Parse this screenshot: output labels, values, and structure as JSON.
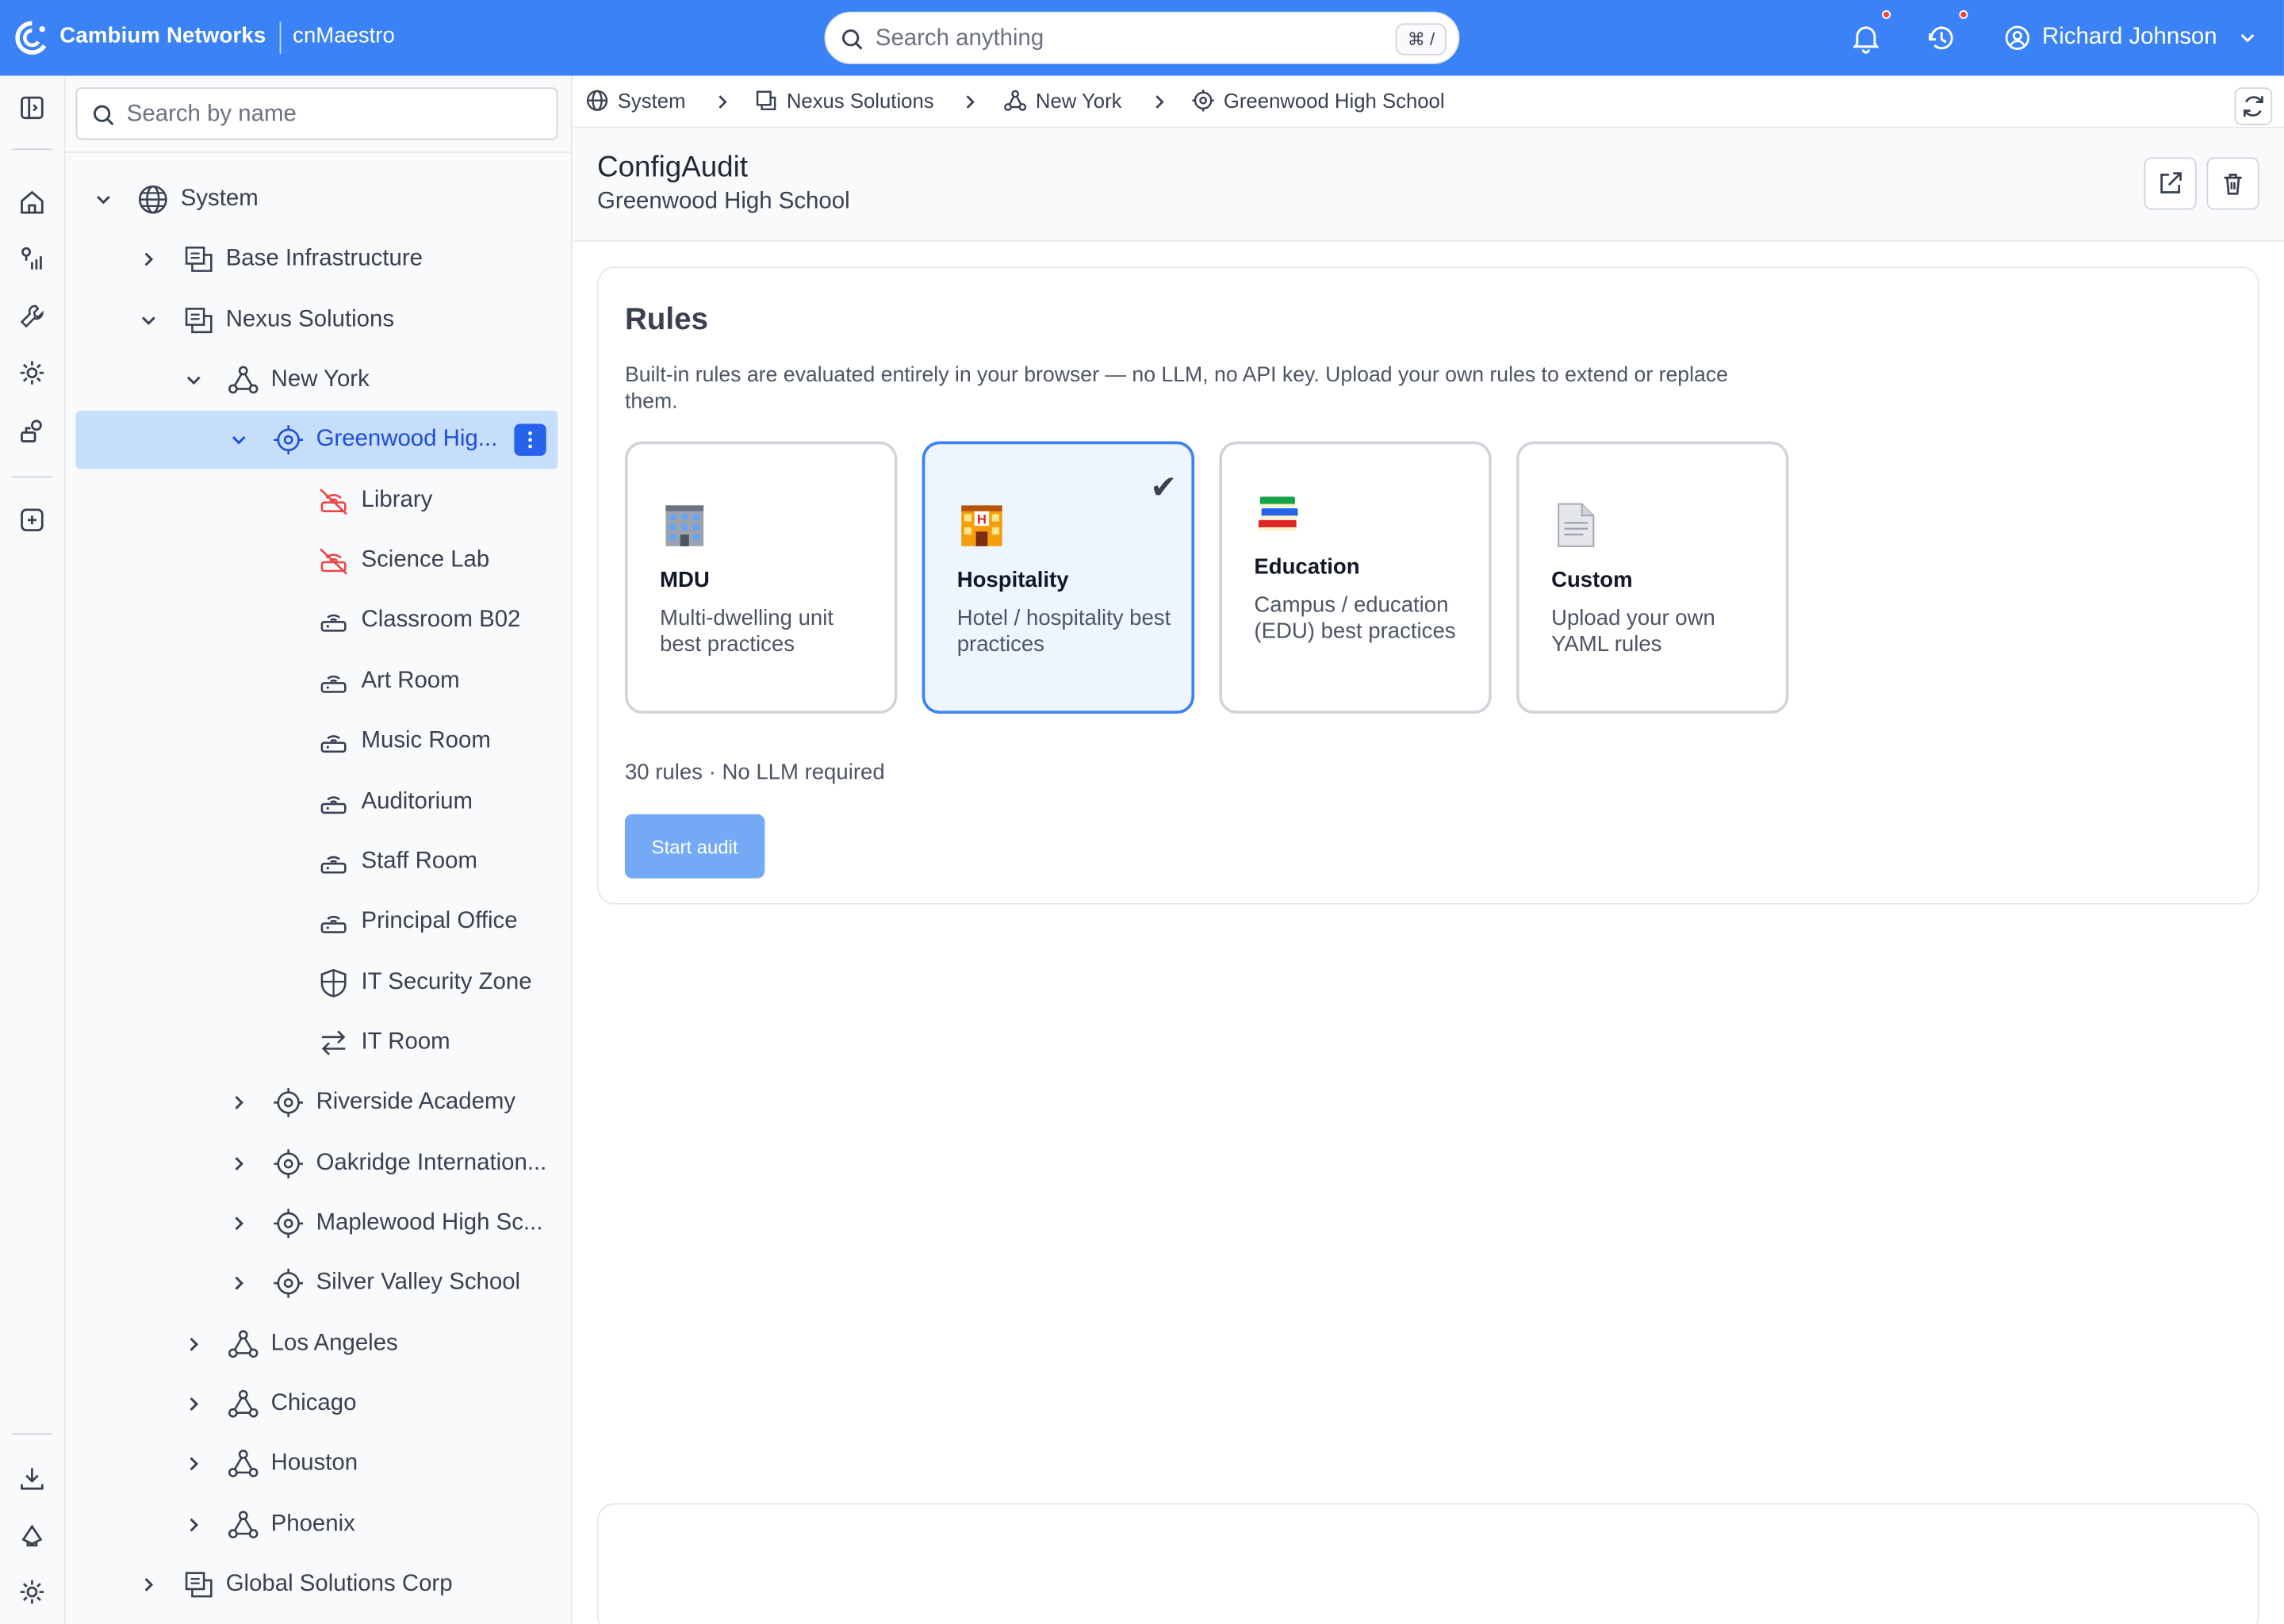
{
  "topbar": {
    "brand": "Cambium Networks",
    "product": "cnMaestro",
    "search_placeholder": "Search anything",
    "shortcut": "⌘ /",
    "user_name": "Richard Johnson",
    "accent_color": "#3b82f6"
  },
  "rail": {
    "icons": [
      "sidebar-toggle-icon",
      "home-icon",
      "monitor-icon",
      "wrench-icon",
      "gear-icon",
      "tools-icon",
      "add-icon",
      "download-icon",
      "feedback-icon",
      "settings-icon"
    ]
  },
  "tree": {
    "search_placeholder": "Search by name",
    "nodes": [
      {
        "label": "System",
        "icon": "globe-icon",
        "expanded": true
      },
      {
        "label": "Base Infrastructure",
        "icon": "org-icon",
        "expanded": false
      },
      {
        "label": "Nexus Solutions",
        "icon": "org-icon",
        "expanded": true
      },
      {
        "label": "New York",
        "icon": "network-icon",
        "expanded": true
      },
      {
        "label": "Greenwood Hig...",
        "icon": "site-icon",
        "expanded": true,
        "selected": true
      },
      {
        "label": "Library",
        "icon": "offline-ap-icon"
      },
      {
        "label": "Science Lab",
        "icon": "offline-ap-icon"
      },
      {
        "label": "Classroom B02",
        "icon": "ap-icon"
      },
      {
        "label": "Art Room",
        "icon": "ap-icon"
      },
      {
        "label": "Music Room",
        "icon": "ap-icon"
      },
      {
        "label": "Auditorium",
        "icon": "ap-icon"
      },
      {
        "label": "Staff Room",
        "icon": "ap-icon"
      },
      {
        "label": "Principal Office",
        "icon": "ap-icon"
      },
      {
        "label": "IT Security Zone",
        "icon": "shield-icon"
      },
      {
        "label": "IT Room",
        "icon": "switch-icon"
      },
      {
        "label": "Riverside Academy",
        "icon": "site-icon",
        "expanded": false
      },
      {
        "label": "Oakridge Internation...",
        "icon": "site-icon",
        "expanded": false
      },
      {
        "label": "Maplewood High Sc...",
        "icon": "site-icon",
        "expanded": false
      },
      {
        "label": "Silver Valley School",
        "icon": "site-icon",
        "expanded": false
      },
      {
        "label": "Los Angeles",
        "icon": "network-icon",
        "expanded": false
      },
      {
        "label": "Chicago",
        "icon": "network-icon",
        "expanded": false
      },
      {
        "label": "Houston",
        "icon": "network-icon",
        "expanded": false
      },
      {
        "label": "Phoenix",
        "icon": "network-icon",
        "expanded": false
      },
      {
        "label": "Global Solutions Corp",
        "icon": "org-icon",
        "expanded": false
      }
    ]
  },
  "breadcrumb": [
    "System",
    "Nexus Solutions",
    "New York",
    "Greenwood High School"
  ],
  "page": {
    "title": "ConfigAudit",
    "subtitle": "Greenwood High School"
  },
  "rules": {
    "title": "Rules",
    "description": "Built-in rules are evaluated entirely in your browser — no LLM, no API key. Upload your own rules to extend or replace them.",
    "options": [
      {
        "name": "MDU",
        "desc": "Multi-dwelling unit best practices",
        "icon": "building-icon",
        "selected": false
      },
      {
        "name": "Hospitality",
        "desc": "Hotel / hospitality best practices",
        "icon": "hotel-icon",
        "selected": true
      },
      {
        "name": "Education",
        "desc": "Campus / education (EDU) best practices",
        "icon": "books-icon",
        "selected": false
      },
      {
        "name": "Custom",
        "desc": "Upload your own YAML rules",
        "icon": "document-icon",
        "selected": false
      }
    ],
    "check_mark": "✔",
    "count_text": "30 rules · No LLM required",
    "start_label": "Start audit"
  }
}
